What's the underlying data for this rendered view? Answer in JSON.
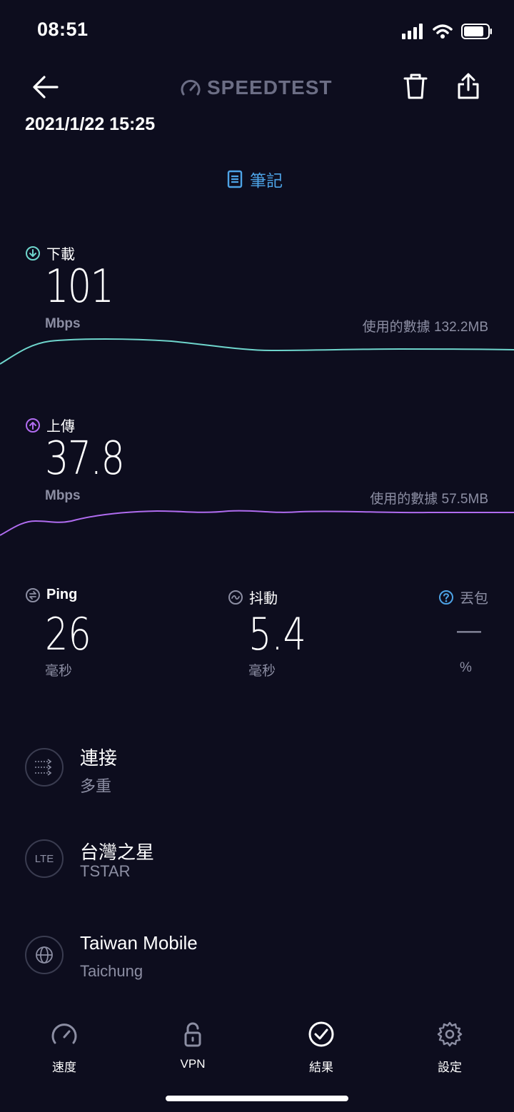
{
  "status_bar": {
    "time": "08:51"
  },
  "header": {
    "logo_text": "SPEEDTEST",
    "date": "2021/1/22 15:25",
    "notes_label": "筆記"
  },
  "download": {
    "label": "下載",
    "value": "101",
    "unit": "Mbps",
    "data_used": "使用的數據 132.2MB"
  },
  "upload": {
    "label": "上傳",
    "value": "37.8",
    "unit": "Mbps",
    "data_used": "使用的數據 57.5MB"
  },
  "ping": {
    "label": "Ping",
    "value": "26",
    "unit": "毫秒"
  },
  "jitter": {
    "label": "抖動",
    "value": "5.4",
    "unit": "毫秒"
  },
  "packet_loss": {
    "label": "丟包",
    "value": "—",
    "unit": "%"
  },
  "connection": {
    "title": "連接",
    "subtitle": "多重"
  },
  "carrier": {
    "icon_text": "LTE",
    "title": "台灣之星",
    "subtitle": "TSTAR"
  },
  "server": {
    "title": "Taiwan Mobile",
    "subtitle": "Taichung"
  },
  "bottom_nav": [
    {
      "label": "速度",
      "icon": "speed-icon"
    },
    {
      "label": "VPN",
      "icon": "lock-icon"
    },
    {
      "label": "結果",
      "icon": "check-circle-icon"
    },
    {
      "label": "設定",
      "icon": "gear-icon"
    }
  ],
  "colors": {
    "background": "#0d0d1e",
    "download": "#6fd6cd",
    "upload": "#b06cf0",
    "accent": "#4da3e6",
    "muted": "#8c8ea3"
  }
}
